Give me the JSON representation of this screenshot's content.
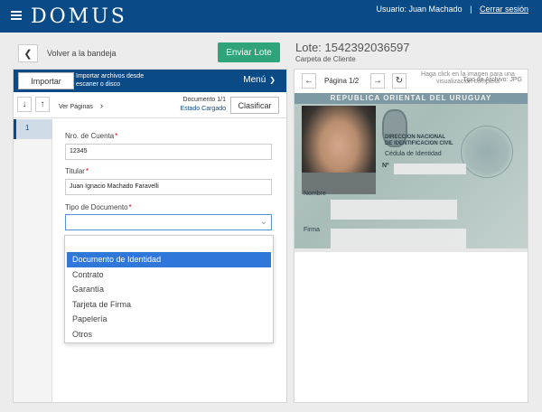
{
  "header": {
    "logo": "DOMUS",
    "user_label": "Usuario: Juan Machado",
    "separator": "|",
    "logout": "Cerrar sesión"
  },
  "left": {
    "back_label": "Volver a la bandeja",
    "send_button": "Enviar Lote",
    "import_button": "Importar",
    "import_desc": "Importar archivos desde escaner o disco",
    "menu_label": "Menú",
    "ver_paginas": "Ver Páginas",
    "documento": "Documento 1/1",
    "estado": "Estado Cargado",
    "clasificar": "Clasificar",
    "thumb_number": "1",
    "nro_cuenta_label": "Nro. de Cuenta",
    "nro_cuenta_value": "12345",
    "titular_label": "Titular",
    "titular_value": "Juan Ignacio Machado Faravelli",
    "tipo_doc_label": "Tipo de Documento",
    "required_mark": "*",
    "options": [
      "Documento de Identidad",
      "Contrato",
      "Garantía",
      "Tarjeta de Firma",
      "Papelería",
      "Otros"
    ]
  },
  "right": {
    "lote_title": "Lote: 1542392036597",
    "carpeta": "Carpeta de Cliente",
    "pagina": "Página 1/2",
    "hint": "Haga click en la imagen para una visualización completa",
    "tipo_archivo": "Tipo de Archivo: JPG",
    "card": {
      "header": "REPUBLICA ORIENTAL DEL URUGUAY",
      "agency_line1": "DIRECCION NACIONAL",
      "agency_line2": "DE IDENTIFICACION CIVIL",
      "doc_type": "Cédula de Identidad",
      "numero_label": "Nº",
      "nombre_label": "Nombre",
      "firma_label": "Firma"
    }
  },
  "colors": {
    "brand_blue": "#0a4a86",
    "send_green": "#2fa37a",
    "selected_blue": "#2f77d9"
  }
}
